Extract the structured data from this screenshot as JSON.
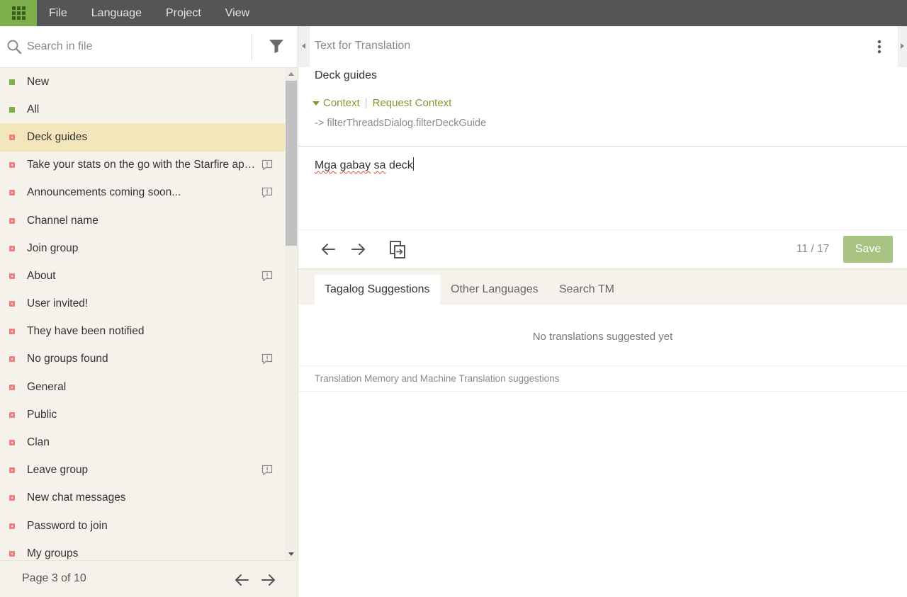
{
  "menubar": {
    "items": [
      "File",
      "Language",
      "Project",
      "View"
    ]
  },
  "sidebar": {
    "search_placeholder": "Search in file",
    "items": [
      {
        "label": "New",
        "status": "green",
        "selected": false,
        "comment": false
      },
      {
        "label": "All",
        "status": "green",
        "selected": false,
        "comment": false
      },
      {
        "label": "Deck guides",
        "status": "red",
        "selected": true,
        "comment": false
      },
      {
        "label": "Take your stats on the go with the Starfire app...",
        "status": "red",
        "selected": false,
        "comment": true
      },
      {
        "label": "Announcements coming soon...",
        "status": "red",
        "selected": false,
        "comment": true
      },
      {
        "label": "Channel name",
        "status": "red",
        "selected": false,
        "comment": false
      },
      {
        "label": "Join group",
        "status": "red",
        "selected": false,
        "comment": false
      },
      {
        "label": "About",
        "status": "red",
        "selected": false,
        "comment": true
      },
      {
        "label": "User invited!",
        "status": "red",
        "selected": false,
        "comment": false
      },
      {
        "label": "They have been notified",
        "status": "red",
        "selected": false,
        "comment": false
      },
      {
        "label": "No groups found",
        "status": "red",
        "selected": false,
        "comment": true
      },
      {
        "label": "General",
        "status": "red",
        "selected": false,
        "comment": false
      },
      {
        "label": "Public",
        "status": "red",
        "selected": false,
        "comment": false
      },
      {
        "label": "Clan",
        "status": "red",
        "selected": false,
        "comment": false
      },
      {
        "label": "Leave group",
        "status": "red",
        "selected": false,
        "comment": true
      },
      {
        "label": "New chat messages",
        "status": "red",
        "selected": false,
        "comment": false
      },
      {
        "label": "Password to join",
        "status": "red",
        "selected": false,
        "comment": false
      },
      {
        "label": "My groups",
        "status": "red",
        "selected": false,
        "comment": false
      }
    ],
    "pager": {
      "text": "Page 3 of 10"
    }
  },
  "editor": {
    "source_header": "Text for Translation",
    "source_text": "Deck guides",
    "context_label": "Context",
    "request_context_label": "Request Context",
    "context_key": "-> filterThreadsDialog.filterDeckGuide",
    "translation_words": [
      "Mga",
      "gabay",
      "sa",
      "deck"
    ],
    "counter": "11 / 17",
    "save_label": "Save"
  },
  "suggestions": {
    "tabs": [
      "Tagalog Suggestions",
      "Other Languages",
      "Search TM"
    ],
    "active_tab": 0,
    "empty_text": "No translations suggested yet",
    "note": "Translation Memory and Machine Translation suggestions"
  },
  "colors": {
    "menubar": "#555555",
    "accent_green": "#7daf4a",
    "status_red": "#ef7f7f",
    "selected_row": "#f3e6bb",
    "save_button": "#a6c382",
    "context_link": "#7f9b2f"
  }
}
